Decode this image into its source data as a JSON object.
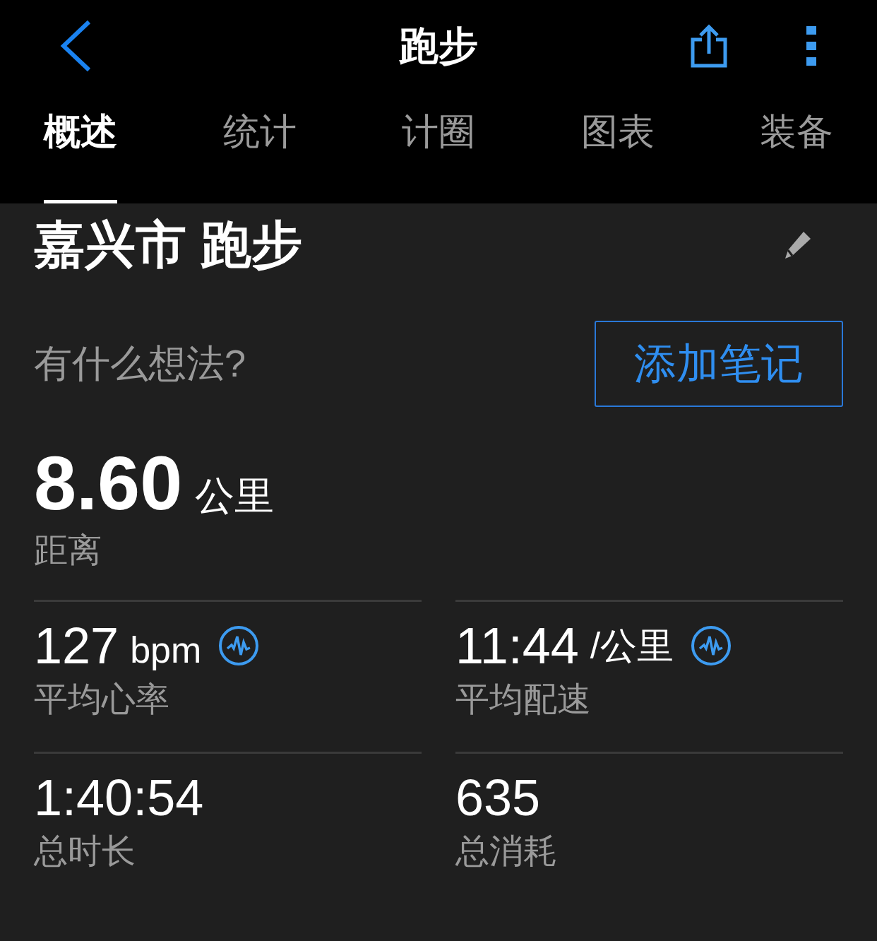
{
  "nav": {
    "title": "跑步"
  },
  "tabs": [
    {
      "label": "概述",
      "selected": true
    },
    {
      "label": "统计",
      "selected": false
    },
    {
      "label": "计圈",
      "selected": false
    },
    {
      "label": "图表",
      "selected": false
    },
    {
      "label": "装备",
      "selected": false
    }
  ],
  "activity": {
    "title": "嘉兴市 跑步",
    "note_placeholder": "有什么想法?",
    "note_button": "添加笔记"
  },
  "distance": {
    "value": "8.60",
    "unit": "公里",
    "label": "距离"
  },
  "stats": [
    {
      "value": "127",
      "unit": "bpm",
      "label": "平均心率",
      "pulse_icon": true
    },
    {
      "value": "11:44",
      "unit": "/公里",
      "label": "平均配速",
      "pulse_icon": true
    },
    {
      "value": "1:40:54",
      "label": "总时长",
      "pulse_icon": false
    },
    {
      "value": "635",
      "label": "总消耗",
      "pulse_icon": false
    }
  ]
}
